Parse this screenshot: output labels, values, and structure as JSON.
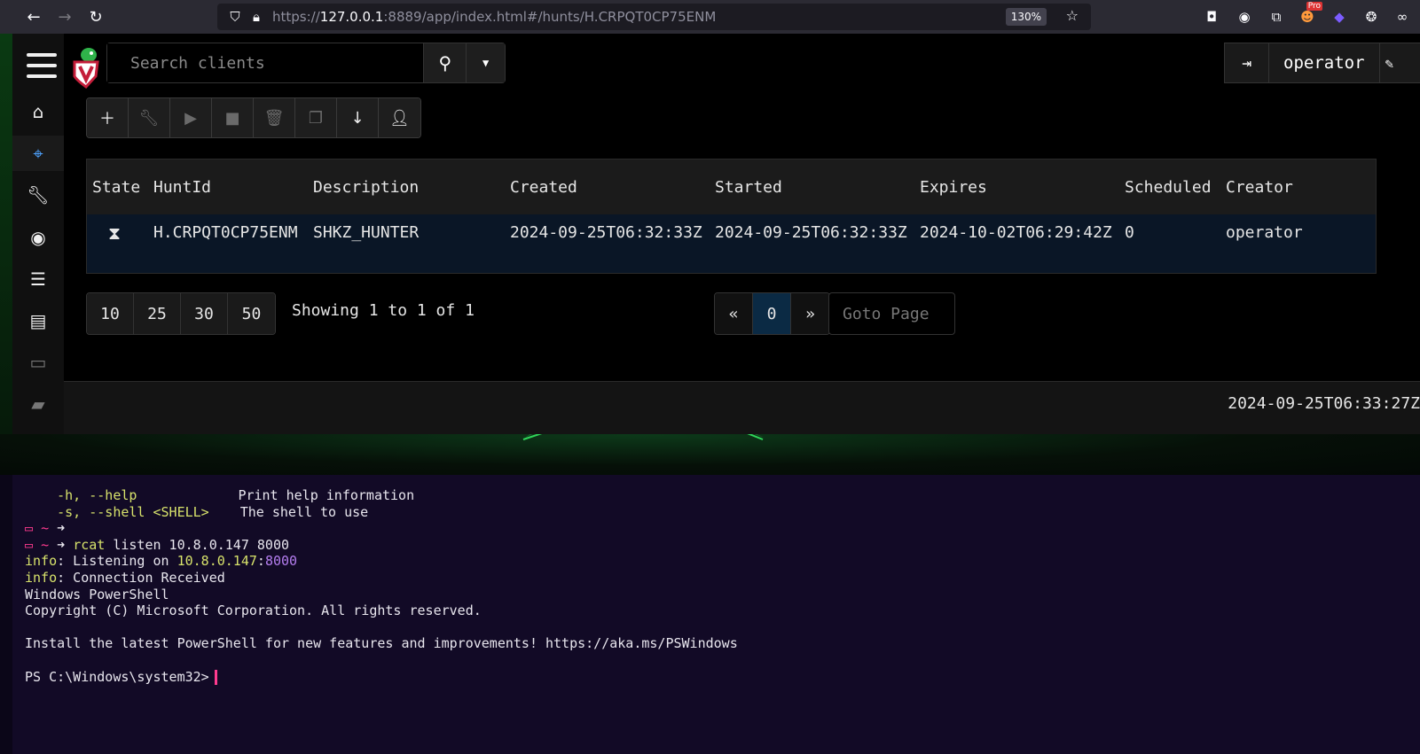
{
  "browser": {
    "url_prefix": "https://",
    "url_host": "127.0.0.1",
    "url_rest": ":8889/app/index.html#/hunts/H.CRPQT0CP75ENM",
    "zoom": "130%",
    "ext_badge": "Pro"
  },
  "header": {
    "search_placeholder": "Search clients",
    "username": "operator"
  },
  "table": {
    "columns": [
      "State",
      "HuntId",
      "Description",
      "Created",
      "Started",
      "Expires",
      "Scheduled",
      "Creator"
    ],
    "rows": [
      {
        "state_icon": "hourglass-icon",
        "hunt_id": "H.CRPQT0CP75ENM",
        "description": "SHKZ_HUNTER",
        "created": "2024-09-25T06:32:33Z",
        "started": "2024-09-25T06:32:33Z",
        "expires": "2024-10-02T06:29:42Z",
        "scheduled": "0",
        "creator": "operator"
      }
    ]
  },
  "pagination": {
    "page_sizes": [
      "10",
      "25",
      "30",
      "50"
    ],
    "showing": "Showing 1 to 1 of 1",
    "prev": "«",
    "current": "0",
    "next": "»",
    "goto_placeholder": "Goto Page"
  },
  "footer": {
    "timestamp": "2024-09-25T06:33:27Z"
  },
  "terminal": {
    "help_flag": "    -h, --help",
    "help_desc": "Print help information",
    "shell_flag": "    -s, --shell <SHELL>",
    "shell_desc": "The shell to use",
    "prompt_tilde": "~",
    "prompt_arrow": "➜",
    "cmd_name": "rcat",
    "cmd_args": " listen 10.8.0.147 8000",
    "info_label": "info",
    "listen_text": ": Listening on ",
    "listen_ip": "10.8.0.147",
    "listen_colon": ":",
    "listen_port": "8000",
    "conn_text": ": Connection Received",
    "ps_title": "Windows PowerShell",
    "copyright": "Copyright (C) Microsoft Corporation. All rights reserved.",
    "install_msg": "Install the latest PowerShell for new features and improvements! https://aka.ms/PSWindows",
    "ps_prompt": "PS C:\\Windows\\system32>"
  }
}
